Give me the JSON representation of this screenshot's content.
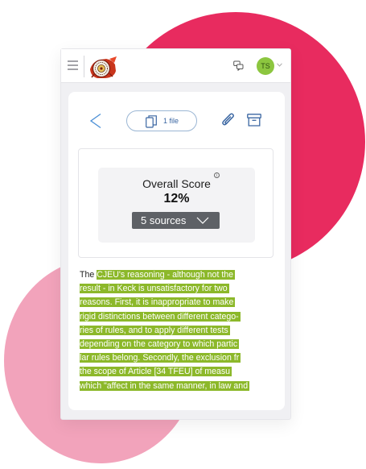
{
  "colors": {
    "blob_red": "#e82b5f",
    "blob_pink": "#f2a3bb",
    "highlight": "#8cb82a",
    "avatar_bg": "#8cc63f",
    "accent_blue": "#3a66a2",
    "sources_button": "#5e6166"
  },
  "header": {
    "menu_icon": "hamburger-icon",
    "logo_icon": "app-logo",
    "chat_icon": "chat-bubbles-icon",
    "avatar_initials": "TS",
    "avatar_menu_icon": "chevron-down-icon"
  },
  "toolbar": {
    "back_icon": "chevron-left-icon",
    "file_icon": "copy-file-icon",
    "file_label": "1 file",
    "attach_icon": "paperclip-icon",
    "archive_icon": "archive-icon"
  },
  "score": {
    "info_icon": "info-icon",
    "info_glyph": "i",
    "title": "Overall Score",
    "value": "12%",
    "sources_label": "5 sources",
    "sources_icon": "chevron-down-icon"
  },
  "document": {
    "first_line_prefix": "The ",
    "first_line_highlight": "CJEU's reasoning - although not the",
    "highlighted_lines": [
      "result - in Keck is unsatisfactory for two",
      "reasons. First, it is inappropriate to make",
      "rigid distinctions between different catego-",
      "ries of rules, and to apply different tests",
      "depending on the category to which partic",
      "lar rules belong. Secondly, the exclusion fr",
      "the scope of Article [34 TFEU] of measu",
      "which \"affect in the same manner, in law and"
    ]
  }
}
